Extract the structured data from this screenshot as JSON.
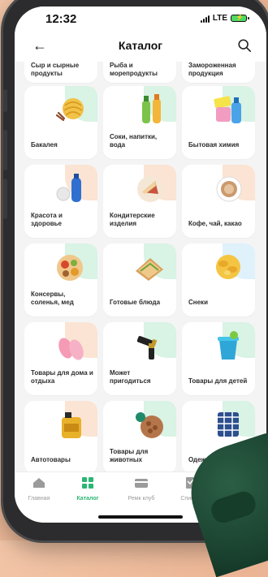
{
  "status": {
    "time": "12:32",
    "network": "LTE"
  },
  "header": {
    "title": "Каталог"
  },
  "top_categories": [
    {
      "label": "Сыр и сырные продукты"
    },
    {
      "label": "Рыба и морепродукты"
    },
    {
      "label": "Замороженная продукция"
    }
  ],
  "categories": [
    {
      "label": "Бакалея",
      "icon": "pasta-icon",
      "accent": "#d9f3e4"
    },
    {
      "label": "Соки, напитки, вода",
      "icon": "juice-bottles-icon",
      "accent": "#d9f3e4"
    },
    {
      "label": "Бытовая химия",
      "icon": "cleaning-supplies-icon",
      "accent": "#d9f3e4"
    },
    {
      "label": "Красота и здоровье",
      "icon": "cosmetics-icon",
      "accent": "#fbe4d3"
    },
    {
      "label": "Кондитерские изделия",
      "icon": "cake-icon",
      "accent": "#fbe4d3"
    },
    {
      "label": "Кофе, чай, какао",
      "icon": "coffee-cup-icon",
      "accent": "#fbe4d3"
    },
    {
      "label": "Консервы, соленья, мед",
      "icon": "canned-food-icon",
      "accent": "#d9f3e4"
    },
    {
      "label": "Готовые блюда",
      "icon": "sandwich-icon",
      "accent": "#d9f3e4"
    },
    {
      "label": "Снеки",
      "icon": "chips-icon",
      "accent": "#dff1fb"
    },
    {
      "label": "Товары для дома и отдыха",
      "icon": "slippers-icon",
      "accent": "#fbe4d3"
    },
    {
      "label": "Может пригодиться",
      "icon": "batteries-icon",
      "accent": "#d9f3e4"
    },
    {
      "label": "Товары для детей",
      "icon": "kids-toys-icon",
      "accent": "#d9f3e4"
    },
    {
      "label": "Автотовары",
      "icon": "motor-oil-icon",
      "accent": "#fbe4d3"
    },
    {
      "label": "Товары для животных",
      "icon": "pet-food-icon",
      "accent": "#d9f3e4"
    },
    {
      "label": "Одежда и об",
      "icon": "clothes-icon",
      "accent": "#d9f3e4"
    }
  ],
  "tabs": [
    {
      "label": "Главная",
      "icon": "home-icon",
      "active": false
    },
    {
      "label": "Каталог",
      "icon": "catalog-icon",
      "active": true
    },
    {
      "label": "Ремк клуб",
      "icon": "card-icon",
      "active": false
    },
    {
      "label": "Списки",
      "icon": "list-icon",
      "active": false
    }
  ],
  "colors": {
    "accent_green": "#2bb673",
    "background": "#f4f4f5"
  }
}
